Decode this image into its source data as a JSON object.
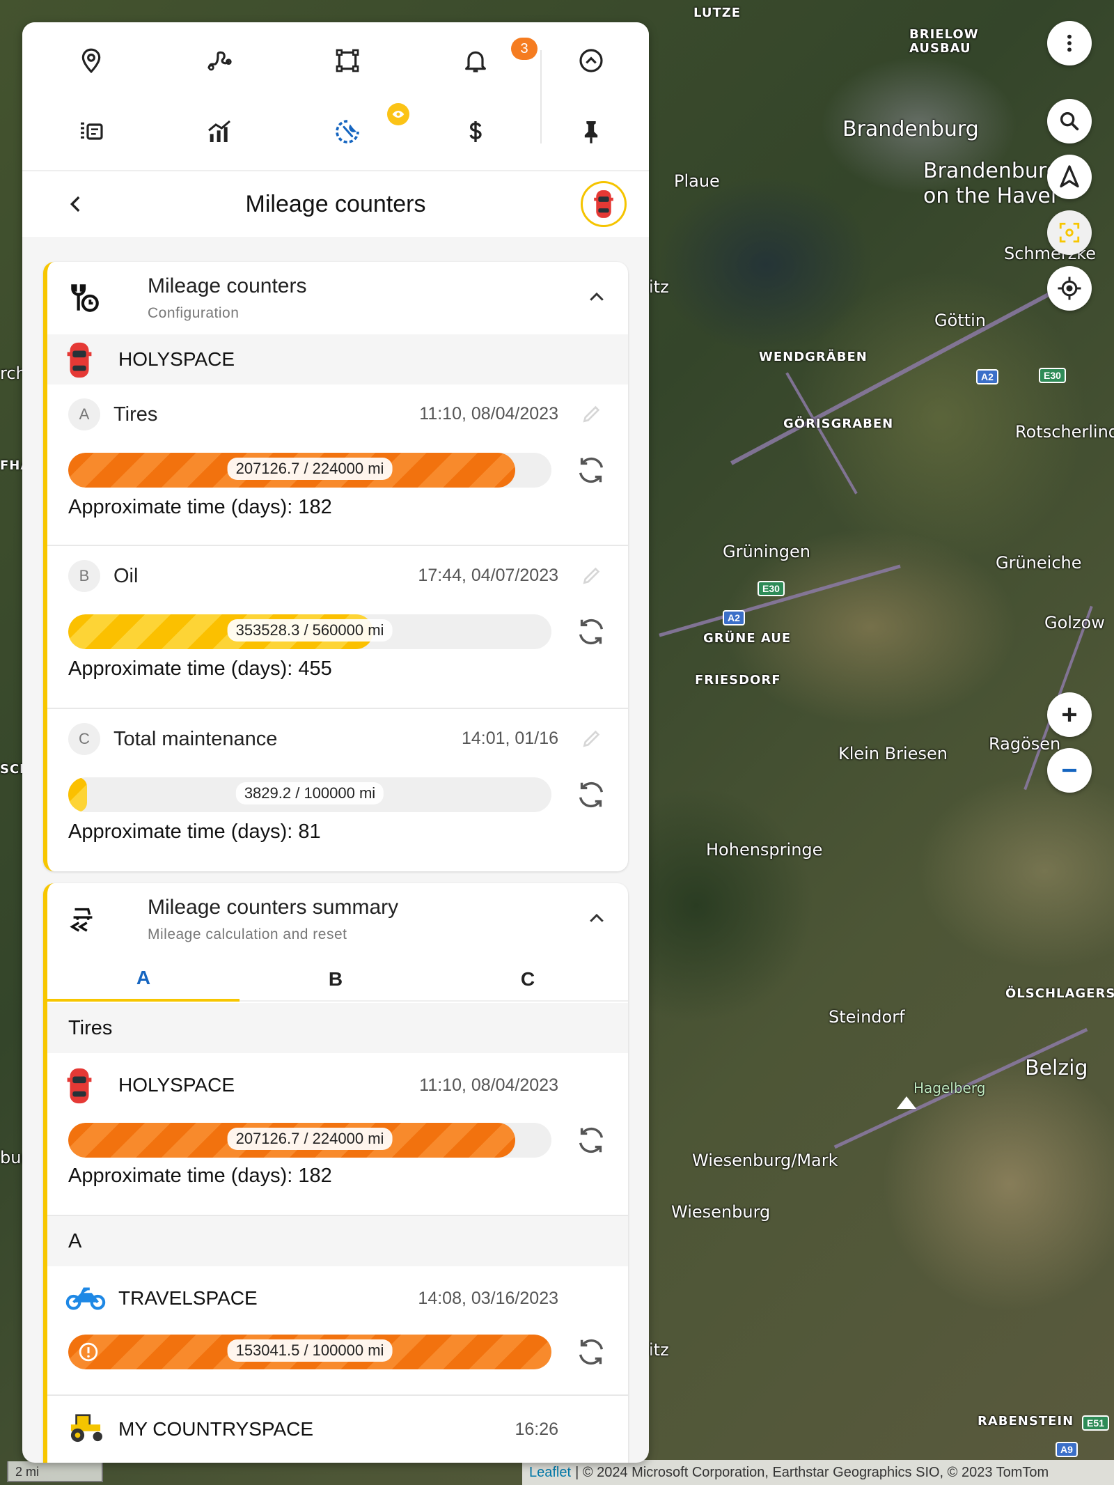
{
  "map": {
    "labels": [
      "LUTZE",
      "BRIELOW AUSBAU",
      "Brandenburg",
      "Brandenburg on the Havel",
      "Plaue",
      "Schmerzke",
      "Göttin",
      "WENDGRÄBEN",
      "GÖRISGRABEN",
      "Rotscherlinde",
      "Grüningen",
      "Grüneiche",
      "Golzow",
      "GRÜNE AUE",
      "FRIESDORF",
      "Klein Briesen",
      "Ragösen",
      "Hohenspringe",
      "ÖLSCHLAGERS",
      "Steindorf",
      "Belzig",
      "Hagelberg",
      "Wiesenburg/Mark",
      "Wiesenburg",
      "RABENSTEIN",
      "itz",
      "itz",
      "rch",
      "FHÄ",
      "SCH",
      "bur"
    ],
    "shields": [
      "A2",
      "E30",
      "E30",
      "A2",
      "E51",
      "A9"
    ],
    "scale_label": "2 mi",
    "attribution_link": "Leaflet",
    "attribution_text": "| © 2024 Microsoft Corporation, Earthstar Geographics SIO, © 2023 TomTom",
    "controls": [
      "more-icon",
      "search-icon",
      "navigation-icon",
      "focus-icon",
      "locate-icon",
      "zoom-in-icon",
      "zoom-out-icon"
    ]
  },
  "toolbar": {
    "row1": [
      "location-pin-icon",
      "route-icon",
      "geofence-icon",
      "bell-icon",
      "collapse-up-icon"
    ],
    "row2": [
      "list-icon",
      "analytics-icon",
      "maintenance-icon",
      "dollar-icon",
      "pin-icon"
    ],
    "notification_count": "3",
    "accent": "#1565c0"
  },
  "header": {
    "title": "Mileage counters"
  },
  "config_card": {
    "title": "Mileage counters",
    "subtitle": "Configuration",
    "vehicle": "HOLYSPACE",
    "counters": [
      {
        "letter": "A",
        "name": "Tires",
        "date": "11:10, 08/04/2023",
        "value": 207126.7,
        "limit": 224000,
        "label": "207126.7 / 224000 mi",
        "approx": "Approximate time (days): 182",
        "color": "orange"
      },
      {
        "letter": "B",
        "name": "Oil",
        "date": "17:44, 04/07/2023",
        "value": 353528.3,
        "limit": 560000,
        "label": "353528.3 / 560000 mi",
        "approx": "Approximate time (days): 455",
        "color": "yellow"
      },
      {
        "letter": "C",
        "name": "Total maintenance",
        "date": "14:01, 01/16",
        "value": 3829.2,
        "limit": 100000,
        "label": "3829.2 / 100000 mi",
        "approx": "Approximate time (days): 81",
        "color": "yellow"
      }
    ]
  },
  "summary_card": {
    "title": "Mileage counters summary",
    "subtitle": "Mileage calculation and reset",
    "tabs": [
      "A",
      "B",
      "C"
    ],
    "active_tab": "A",
    "groups": [
      {
        "name": "Tires",
        "vehicles": [
          {
            "name": "HOLYSPACE",
            "date": "11:10, 08/04/2023",
            "label": "207126.7 / 224000 mi",
            "value": 207126.7,
            "limit": 224000,
            "approx": "Approximate time (days): 182"
          }
        ]
      },
      {
        "name": "A",
        "vehicles": [
          {
            "name": "TRAVELSPACE",
            "date": "14:08, 03/16/2023",
            "label": "153041.5 / 100000 mi",
            "value": 153041.5,
            "limit": 100000,
            "overdue": true
          },
          {
            "name": "MY COUNTRYSPACE",
            "date": "16:26"
          }
        ]
      }
    ]
  },
  "colors": {
    "orange": "#f2720e",
    "yellow": "#fbc000",
    "card_accent": "#f7c600",
    "badge": "#f57c20"
  }
}
